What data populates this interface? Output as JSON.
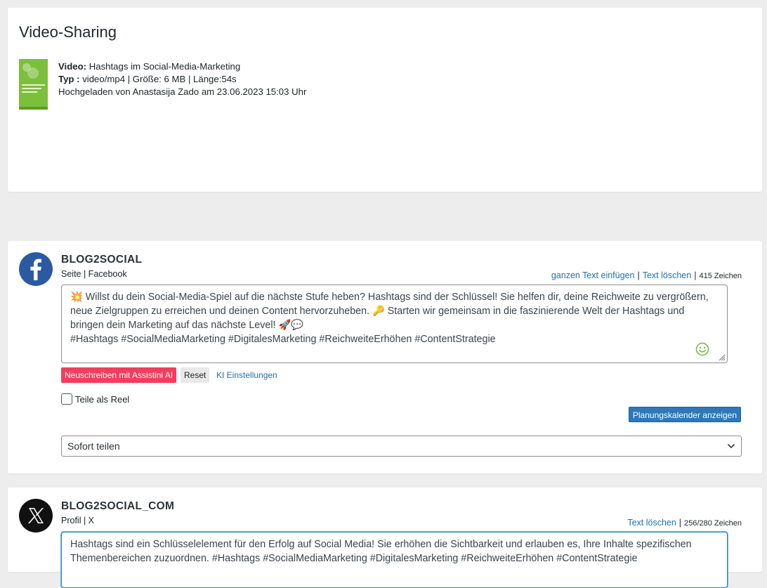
{
  "video_section": {
    "title": "Video-Sharing",
    "video_label": "Video:",
    "video_title": "Hashtags im Social-Media-Marketing",
    "type_label": "Typ :",
    "type_value": "video/mp4 | Größe: 6 MB | Länge:54s",
    "uploaded": "Hochgeladen von Anastasija Zado am 23.06.2023 15:03 Uhr"
  },
  "facebook": {
    "account_name": "BLOG2SOCIAL",
    "account_type": "Seite | Facebook",
    "insert_full_text": "ganzen Text einfügen",
    "delete_text": "Text löschen",
    "char_count": "415 Zeichen",
    "post_line1": "💥 Willst du dein Social-Media-Spiel auf die nächste Stufe heben? Hashtags sind der Schlüssel! Sie helfen dir, deine Reichweite zu vergrößern, neue Zielgruppen zu erreichen und deinen Content hervorzuheben. 🔑 Starten wir gemeinsam in die faszinierende Welt der Hashtags und bringen dein Marketing auf das nächste Level! 🚀💬",
    "post_line2": "#Hashtags #SocialMediaMarketing #DigitalesMarketing #ReichweiteErhöhen #ContentStrategie",
    "rewrite_button": "Neuschreiben mit Assistini AI",
    "reset_button": "Reset",
    "ki_settings": "KI Einstellungen",
    "reel_label": "Teile als Reel",
    "calendar_button": "Planungskalender anzeigen",
    "schedule_select": "Sofort teilen"
  },
  "x": {
    "account_name": "BLOG2SOCIAL_COM",
    "account_type": "Profil | X",
    "delete_text": "Text löschen",
    "char_count": "256/280 Zeichen",
    "post_text": "Hashtags sind ein Schlüsselelement für den Erfolg auf Social Media! Sie erhöhen die Sichtbarkeit und erlauben es, Ihre Inhalte spezifischen Themenbereichen zuzuordnen. #Hashtags #SocialMediaMarketing #DigitalesMarketing #ReichweiteErhöhen #ContentStrategie"
  },
  "colors": {
    "background": "#ededed",
    "link": "#2271b1",
    "ai_button": "#f43c5d",
    "primary_button": "#2c78ba",
    "facebook_blue": "#2b5aa3",
    "thumbnail_green": "#7cbf3a"
  }
}
